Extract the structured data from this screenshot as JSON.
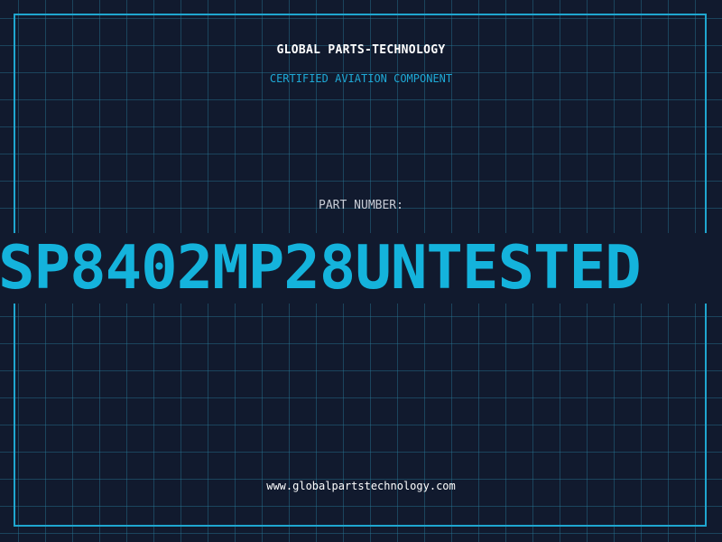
{
  "header": {
    "company": "GLOBAL PARTS-TECHNOLOGY",
    "subtitle": "CERTIFIED AVIATION COMPONENT"
  },
  "part": {
    "label": "PART NUMBER:",
    "number": "SP8402MP28UNTESTED"
  },
  "footer": {
    "website": "www.globalpartstechnology.com"
  },
  "colors": {
    "background": "#111a2e",
    "grid": "#28789b",
    "accent": "#1fa6cf",
    "text": "#ffffff"
  }
}
